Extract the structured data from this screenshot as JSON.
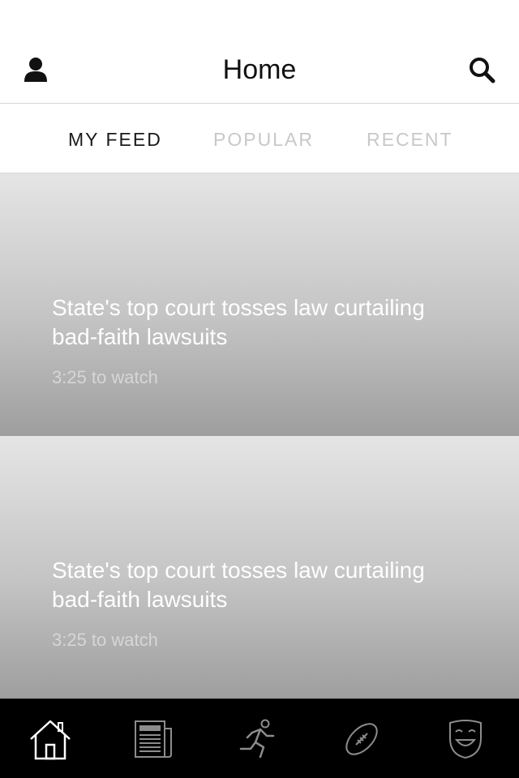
{
  "header": {
    "title": "Home",
    "profile_icon": "user-icon",
    "search_icon": "search-icon"
  },
  "tabs": [
    {
      "label": "MY FEED",
      "active": true
    },
    {
      "label": "POPULAR",
      "active": false
    },
    {
      "label": "RECENT",
      "active": false
    }
  ],
  "feed": [
    {
      "headline": "State's top court tosses law curtailing bad-faith lawsuits",
      "duration": "3:25 to watch"
    },
    {
      "headline": "State's top court tosses law curtailing bad-faith lawsuits",
      "duration": "3:25 to watch"
    }
  ],
  "tabbar": [
    {
      "icon": "home-icon",
      "active": true
    },
    {
      "icon": "newspaper-icon",
      "active": false
    },
    {
      "icon": "running-person-icon",
      "active": false
    },
    {
      "icon": "football-icon",
      "active": false
    },
    {
      "icon": "theater-mask-icon",
      "active": false
    }
  ],
  "colors": {
    "tabbar_background": "#000000",
    "active_icon": "#ffffff",
    "inactive_icon": "#8c8c8c",
    "active_tab_text": "#1a1a1a",
    "inactive_tab_text": "#c8c8c8"
  }
}
